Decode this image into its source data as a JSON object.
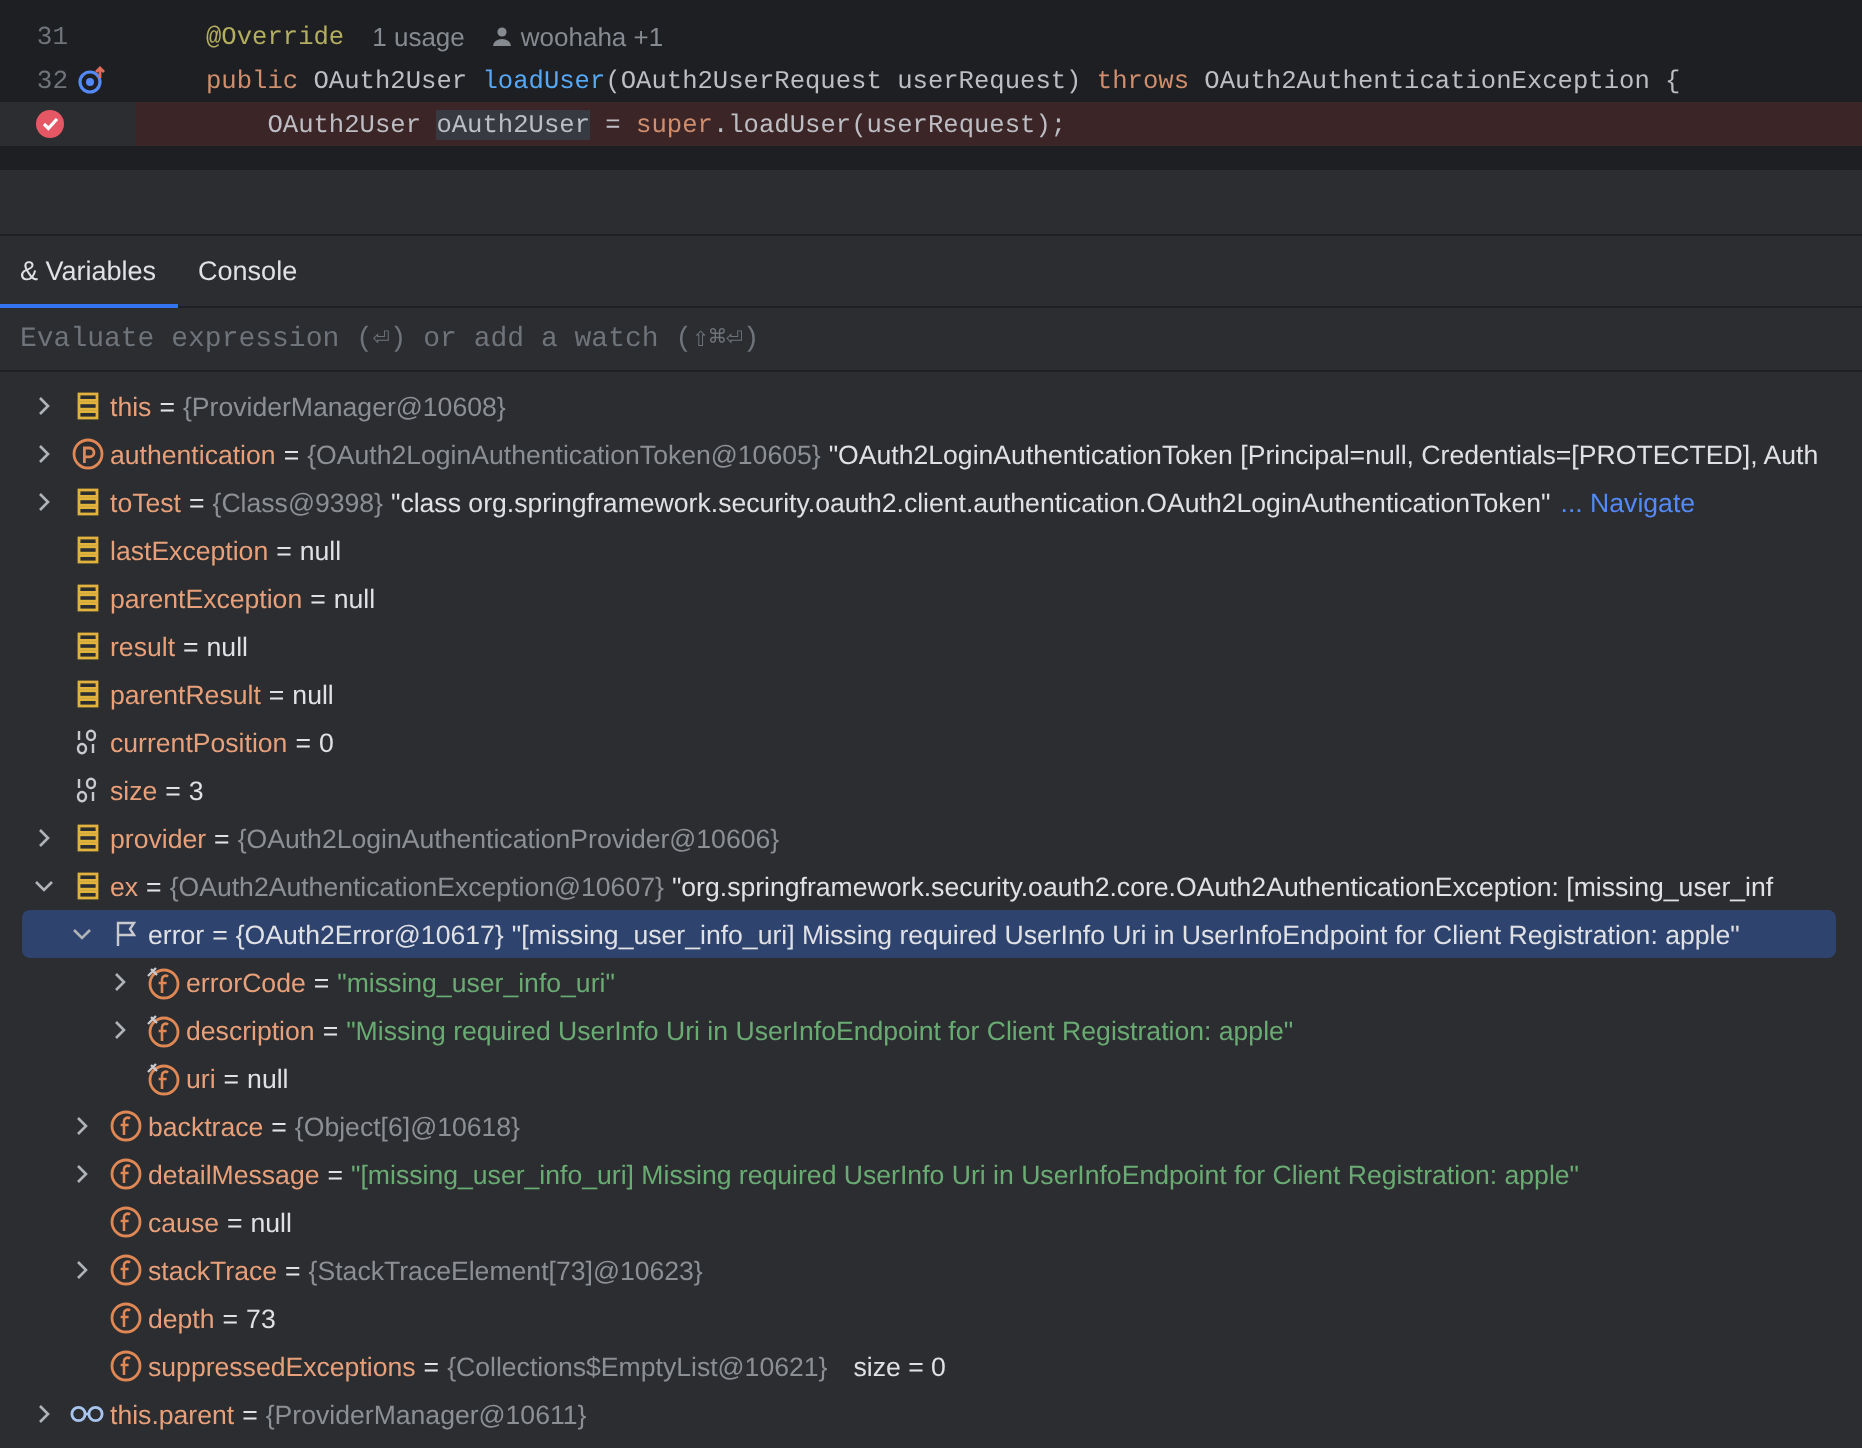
{
  "editor": {
    "lines": [
      {
        "number": "31",
        "kind": "plain",
        "tokens": [
          {
            "kind": "annotation",
            "text": "@Override"
          }
        ],
        "hints": [
          {
            "kind": "usage",
            "text": "1 usage"
          },
          {
            "kind": "author",
            "text": "woohaha +1"
          }
        ]
      },
      {
        "number": "32",
        "kind": "implements",
        "tokens": [
          {
            "kind": "keyword",
            "text": "public"
          },
          {
            "kind": "plain",
            "text": " OAuth2User "
          },
          {
            "kind": "method",
            "text": "loadUser"
          },
          {
            "kind": "plain",
            "text": "(OAuth2UserRequest userRequest) "
          },
          {
            "kind": "keyword",
            "text": "throws"
          },
          {
            "kind": "plain",
            "text": " OAuth2AuthenticationException {"
          }
        ]
      },
      {
        "kind": "breakpoint",
        "tokens": [
          {
            "kind": "plain",
            "text": "    OAuth2User "
          },
          {
            "kind": "highlight",
            "text": "oAuth2User"
          },
          {
            "kind": "plain",
            "text": " = "
          },
          {
            "kind": "keyword",
            "text": "super"
          },
          {
            "kind": "plain",
            "text": ".loadUser(userRequest);"
          }
        ]
      }
    ]
  },
  "tabs": [
    {
      "label": "& Variables",
      "selected": true
    },
    {
      "label": "Console",
      "selected": false
    }
  ],
  "watch_field": {
    "placeholder": "Evaluate expression (⏎) or add a watch (⇧⌘⏎)"
  },
  "variables": [
    {
      "name": "this",
      "op": "=",
      "kind": "local",
      "expanded": false,
      "selected": false,
      "ref": "{ProviderManager@10608}"
    },
    {
      "name": "authentication",
      "op": "=",
      "kind": "parameter",
      "expanded": false,
      "selected": false,
      "ref": "{OAuth2LoginAuthenticationToken@10605}",
      "value": "\"OAuth2LoginAuthenticationToken [Principal=null, Credentials=[PROTECTED], Auth"
    },
    {
      "name": "toTest",
      "op": "=",
      "kind": "local",
      "expanded": false,
      "selected": false,
      "ref": "{Class@9398}",
      "value": "\"class org.springframework.security.oauth2.client.authentication.OAuth2LoginAuthenticationToken\"",
      "link": "... Navigate"
    },
    {
      "name": "lastException",
      "op": "=",
      "kind": "local",
      "selected": false,
      "value": "null"
    },
    {
      "name": "parentException",
      "op": "=",
      "kind": "local",
      "selected": false,
      "value": "null"
    },
    {
      "name": "result",
      "op": "=",
      "kind": "local",
      "selected": false,
      "value": "null"
    },
    {
      "name": "parentResult",
      "op": "=",
      "kind": "local",
      "selected": false,
      "value": "null"
    },
    {
      "name": "currentPosition",
      "op": "=",
      "kind": "primitive",
      "selected": false,
      "value": "0"
    },
    {
      "name": "size",
      "op": "=",
      "kind": "primitive",
      "selected": false,
      "value": "3"
    },
    {
      "name": "provider",
      "op": "=",
      "kind": "local",
      "expanded": false,
      "selected": false,
      "ref": "{OAuth2LoginAuthenticationProvider@10606}"
    },
    {
      "name": "ex",
      "op": "=",
      "kind": "local",
      "expanded": true,
      "selected": false,
      "ref": "{OAuth2AuthenticationException@10607}",
      "value": "\"org.springframework.security.oauth2.core.OAuth2AuthenticationException: [missing_user_inf",
      "children": [
        {
          "name": "error",
          "op": "=",
          "kind": "flag",
          "expanded": true,
          "selected": true,
          "ref": "{OAuth2Error@10617}",
          "value": "\"[missing_user_info_uri] Missing required UserInfo Uri in UserInfoEndpoint for Client Registration: apple\"",
          "children": [
            {
              "name": "errorCode",
              "op": "=",
              "kind": "final-field",
              "expanded": false,
              "selected": false,
              "string": "\"missing_user_info_uri\""
            },
            {
              "name": "description",
              "op": "=",
              "kind": "final-field",
              "expanded": false,
              "selected": false,
              "string": "\"Missing required UserInfo Uri in UserInfoEndpoint for Client Registration: apple\""
            },
            {
              "name": "uri",
              "op": "=",
              "kind": "final-field",
              "selected": false,
              "value": "null"
            }
          ]
        },
        {
          "name": "backtrace",
          "op": "=",
          "kind": "field",
          "expanded": false,
          "selected": false,
          "ref": "{Object[6]@10618}"
        },
        {
          "name": "detailMessage",
          "op": "=",
          "kind": "field",
          "expanded": false,
          "selected": false,
          "string": "\"[missing_user_info_uri] Missing required UserInfo Uri in UserInfoEndpoint for Client Registration: apple\""
        },
        {
          "name": "cause",
          "op": "=",
          "kind": "field",
          "selected": false,
          "value": "null"
        },
        {
          "name": "stackTrace",
          "op": "=",
          "kind": "field",
          "expanded": false,
          "selected": false,
          "ref": "{StackTraceElement[73]@10623}"
        },
        {
          "name": "depth",
          "op": "=",
          "kind": "field",
          "selected": false,
          "value": "73"
        },
        {
          "name": "suppressedExceptions",
          "op": "=",
          "kind": "field",
          "selected": false,
          "ref": "{Collections$EmptyList@10621}",
          "extra": "size = 0"
        }
      ]
    },
    {
      "name": "this.parent",
      "op": "=",
      "kind": "watch",
      "expanded": false,
      "selected": false,
      "ref": "{ProviderManager@10611}"
    }
  ]
}
